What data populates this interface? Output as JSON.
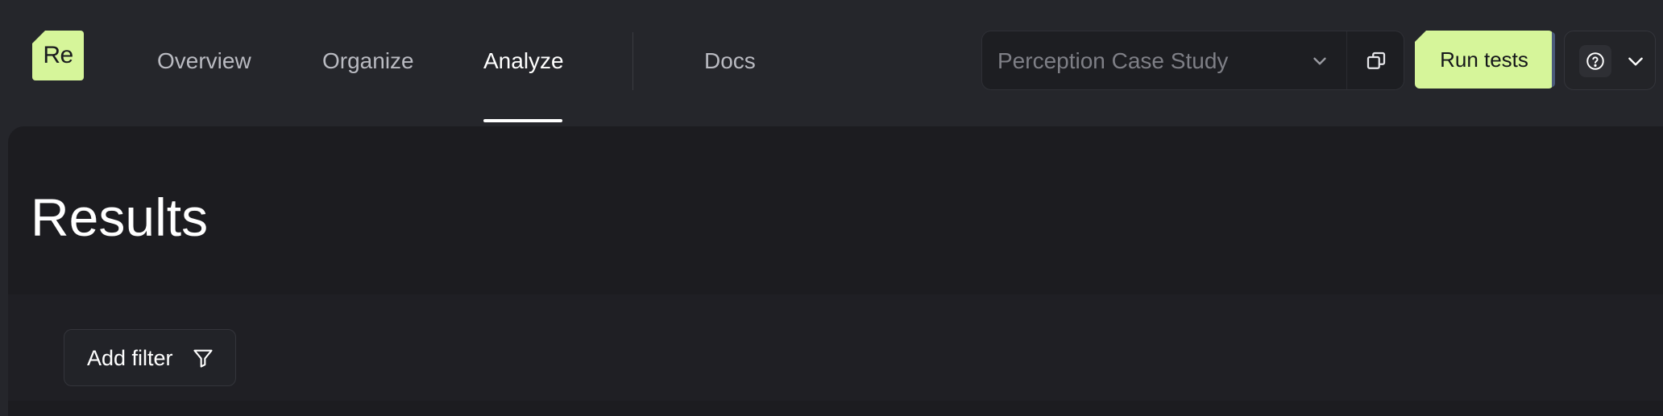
{
  "app": {
    "logo_text": "Re"
  },
  "nav": {
    "items": [
      {
        "label": "Overview"
      },
      {
        "label": "Organize"
      },
      {
        "label": "Analyze",
        "active": true
      },
      {
        "label": "Docs"
      }
    ]
  },
  "toolbar": {
    "project_select": {
      "value": "Perception Case Study",
      "icons": [
        "chevron-down-icon",
        "copy-icon"
      ]
    },
    "run_button_label": "Run tests",
    "help_icon": "help-circle-icon",
    "menu_icon": "chevron-down-icon"
  },
  "page": {
    "title": "Results"
  },
  "filters": {
    "add_filter_label": "Add filter",
    "icon": "filter-icon"
  },
  "colors": {
    "accent": "#d6f59a",
    "background": "#25262b",
    "panel": "#1c1c20"
  }
}
